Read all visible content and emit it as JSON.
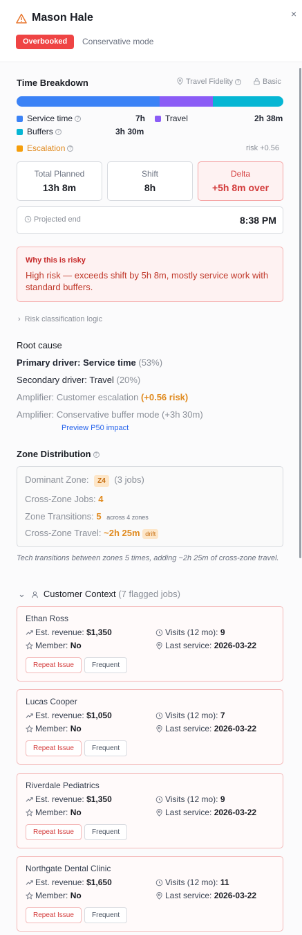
{
  "header": {
    "title": "Mason Hale",
    "badge": "Overbooked",
    "mode": "Conservative mode",
    "close": "×"
  },
  "time_breakdown": {
    "title": "Time Breakdown",
    "fidelity_label": "Travel Fidelity",
    "fidelity_value": "Basic",
    "bar_fractions": {
      "service": 0.535,
      "travel": 0.2,
      "buffers": 0.265
    },
    "colors": {
      "service": "#3b82f6",
      "travel": "#8b5cf6",
      "buffers": "#06b6d4",
      "escalation": "#f59e0b"
    },
    "legend": [
      {
        "label": "Service time",
        "value": "7h"
      },
      {
        "label": "Travel",
        "value": "2h 38m"
      },
      {
        "label": "Buffers",
        "value": "3h 30m"
      }
    ],
    "escalation_label": "Escalation",
    "escalation_value": "risk +0.56"
  },
  "stats": {
    "total_label": "Total Planned",
    "total_value": "13h 8m",
    "shift_label": "Shift",
    "shift_value": "8h",
    "delta_label": "Delta",
    "delta_value": "+5h 8m over"
  },
  "projected": {
    "label": "Projected end",
    "value": "8:38 PM"
  },
  "risk": {
    "title": "Why this is risky",
    "text": "High risk — exceeds shift by 5h 8m, mostly service work with standard buffers."
  },
  "logic_link": "Risk classification logic",
  "root_cause": {
    "title": "Root cause",
    "primary_label": "Primary driver:",
    "primary_value": "Service time",
    "primary_pct": "(53%)",
    "secondary_label": "Secondary driver:",
    "secondary_value": "Travel",
    "secondary_pct": "(20%)",
    "amp1_label": "Amplifier:",
    "amp1_value": "Customer escalation",
    "amp1_extra": "(+0.56 risk)",
    "amp2_label": "Amplifier:",
    "amp2_value": "Conservative buffer mode (+3h 30m)",
    "preview_link": "Preview P50 impact"
  },
  "zone": {
    "title": "Zone Distribution",
    "dominant_label": "Dominant Zone:",
    "dominant_zone": "Z4",
    "dominant_jobs": "(3 jobs)",
    "cross_label": "Cross-Zone Jobs:",
    "cross_value": "4",
    "trans_label": "Zone Transitions:",
    "trans_value": "5",
    "trans_note": "across 4 zones",
    "travel_label": "Cross-Zone Travel:",
    "travel_value": "~2h 25m",
    "drift": "drift",
    "note": "Tech transitions between zones 5 times, adding ~2h 25m of cross-zone travel."
  },
  "customer": {
    "title": "Customer Context",
    "count": "(7 flagged jobs)",
    "labels": {
      "revenue": "Est. revenue:",
      "visits": "Visits (12 mo):",
      "member": "Member:",
      "last": "Last service:",
      "repeat": "Repeat Issue",
      "frequent": "Frequent"
    },
    "jobs": [
      {
        "name": "Ethan Ross",
        "revenue": "$1,350",
        "visits": "9",
        "member": "No",
        "last": "2026-03-22"
      },
      {
        "name": "Lucas Cooper",
        "revenue": "$1,050",
        "visits": "7",
        "member": "No",
        "last": "2026-03-22"
      },
      {
        "name": "Riverdale Pediatrics",
        "revenue": "$1,350",
        "visits": "9",
        "member": "No",
        "last": "2026-03-22"
      },
      {
        "name": "Northgate Dental Clinic",
        "revenue": "$1,650",
        "visits": "11",
        "member": "No",
        "last": "2026-03-22"
      }
    ]
  }
}
